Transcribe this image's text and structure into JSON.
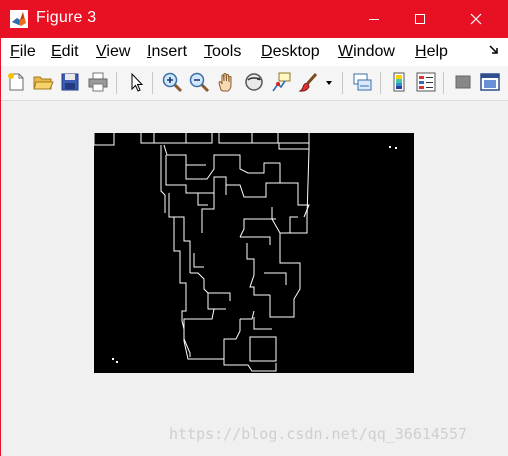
{
  "window": {
    "title": "Figure 3",
    "buttons": {
      "minimize": "minimize-icon",
      "maximize": "maximize-icon",
      "close": "close-icon"
    },
    "accent_color": "#e81123"
  },
  "menu": {
    "items": [
      {
        "pre": "",
        "mn": "F",
        "rest": "ile"
      },
      {
        "pre": "",
        "mn": "E",
        "rest": "dit"
      },
      {
        "pre": "",
        "mn": "V",
        "rest": "iew"
      },
      {
        "pre": "",
        "mn": "I",
        "rest": "nsert"
      },
      {
        "pre": "",
        "mn": "T",
        "rest": "ools"
      },
      {
        "pre": "",
        "mn": "D",
        "rest": "esktop"
      },
      {
        "pre": "",
        "mn": "W",
        "rest": "indow"
      },
      {
        "pre": "",
        "mn": "H",
        "rest": "elp"
      }
    ]
  },
  "toolbar": {
    "icons": [
      "new-figure-icon",
      "open-file-icon",
      "save-icon",
      "print-icon",
      "pointer-icon",
      "zoom-in-icon",
      "zoom-out-icon",
      "pan-hand-icon",
      "rotate-3d-icon",
      "data-cursor-icon",
      "brush-icon",
      "dropdown-arrow-icon",
      "link-plot-icon",
      "colorbar-icon",
      "legend-icon",
      "hide-plot-tools-icon",
      "show-plot-tools-icon"
    ]
  },
  "figure": {
    "image_description_colors": {
      "background": "#000000",
      "edges": "#ffffff"
    }
  },
  "watermark": {
    "text": "https://blog.csdn.net/qq_36614557"
  }
}
